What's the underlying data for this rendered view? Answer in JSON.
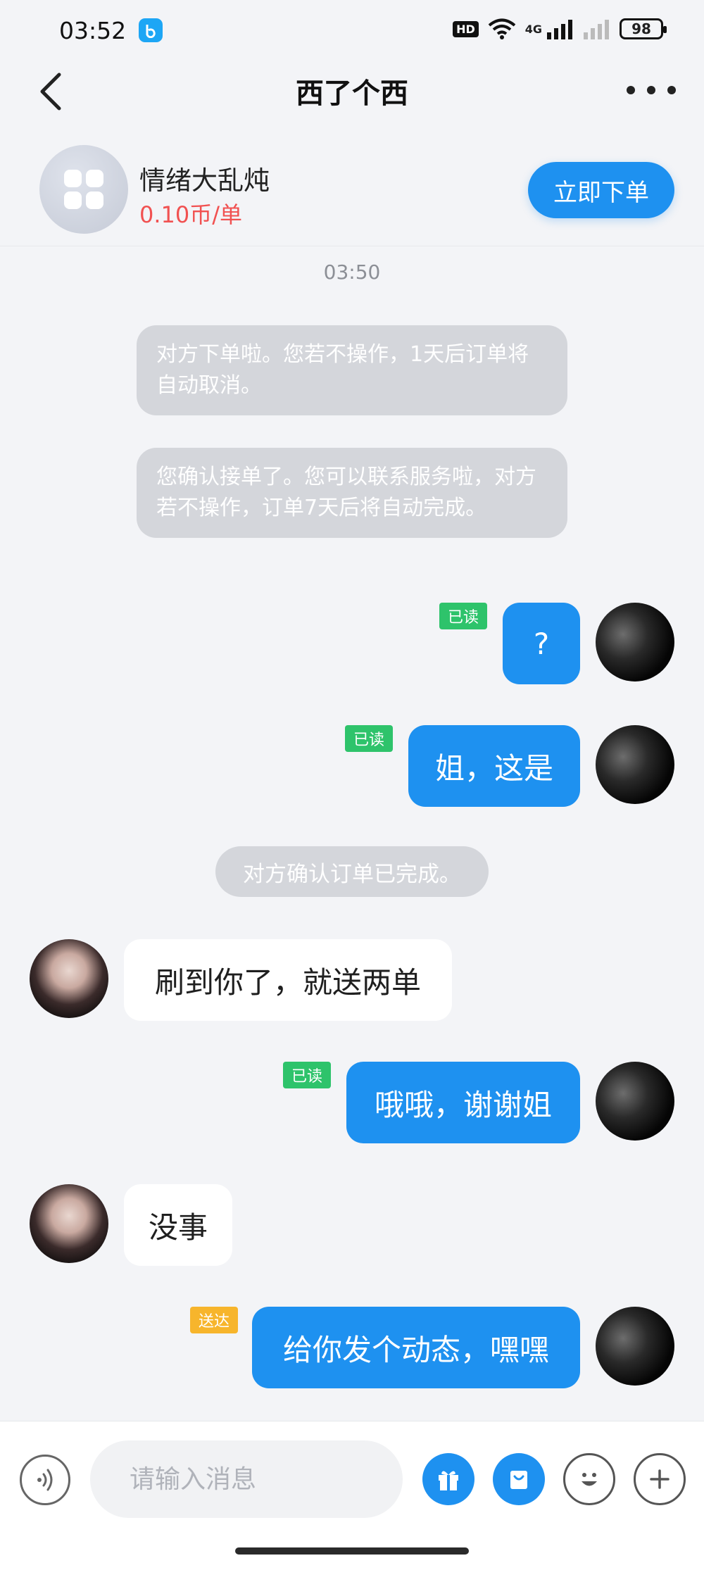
{
  "status_bar": {
    "time": "03:52",
    "hd_label": "HD",
    "network": "4G",
    "battery": "98"
  },
  "header": {
    "title": "西了个西"
  },
  "product": {
    "name": "情绪大乱炖",
    "price": "0.10币/单",
    "order_button": "立即下单"
  },
  "chat": {
    "timestamp": "03:50",
    "system_messages": [
      "对方下单啦。您若不操作，1天后订单将自动取消。",
      "您确认接单了。您可以联系服务啦，对方若不操作，订单7天后将自动完成。"
    ],
    "messages": [
      {
        "from": "me",
        "text": "?",
        "status": "已读"
      },
      {
        "from": "me",
        "text": "姐，这是",
        "status": "已读"
      },
      {
        "from": "system",
        "text": "对方确认订单已完成。"
      },
      {
        "from": "her",
        "text": "刷到你了，就送两单"
      },
      {
        "from": "me",
        "text": "哦哦，谢谢姐",
        "status": "已读"
      },
      {
        "from": "her",
        "text": "没事"
      },
      {
        "from": "me",
        "text": "给你发个动态，嘿嘿",
        "status": "送达"
      }
    ]
  },
  "input_bar": {
    "placeholder": "请输入消息"
  },
  "colors": {
    "accent": "#1e91f0",
    "price_red": "#f15151",
    "read_green": "#2ec36b",
    "sent_yellow": "#f7b52c",
    "background": "#f3f4f7"
  },
  "icons": [
    "back-arrow-icon",
    "more-dots-icon",
    "grid-apps-icon",
    "voice-icon",
    "gift-icon",
    "shop-bag-icon",
    "emoji-icon",
    "plus-icon"
  ]
}
